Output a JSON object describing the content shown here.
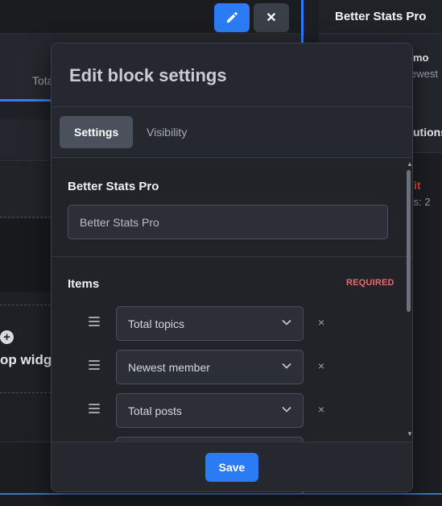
{
  "background": {
    "tab_label": "Tota",
    "widget_text": "op widg",
    "plus_symbol": "+",
    "edit_button_icon": "pencil-icon",
    "close_button_label": "✕"
  },
  "right_panel": {
    "title": "Better Stats Pro",
    "line1": "mo",
    "line2": "ewest",
    "line3": "utions",
    "line4": "it",
    "line5": "ts: 2"
  },
  "modal": {
    "title": "Edit block settings",
    "tabs": [
      {
        "label": "Settings",
        "active": true
      },
      {
        "label": "Visibility",
        "active": false
      }
    ],
    "name_section": {
      "label": "Better Stats Pro",
      "input_value": "Better Stats Pro"
    },
    "items_section": {
      "label": "Items",
      "required_badge": "REQUIRED",
      "items": [
        {
          "label": "Total topics",
          "remove": "×"
        },
        {
          "label": "Newest member",
          "remove": "×"
        },
        {
          "label": "Total posts",
          "remove": "×"
        },
        {
          "label": "",
          "remove": ""
        }
      ]
    },
    "scroll_up": "▲",
    "scroll_down": "▼",
    "save_label": "Save"
  },
  "colors": {
    "accent": "#2b7cf4",
    "required": "#e86b66",
    "modal_bg": "#25282e",
    "body_bg": "#212328"
  }
}
